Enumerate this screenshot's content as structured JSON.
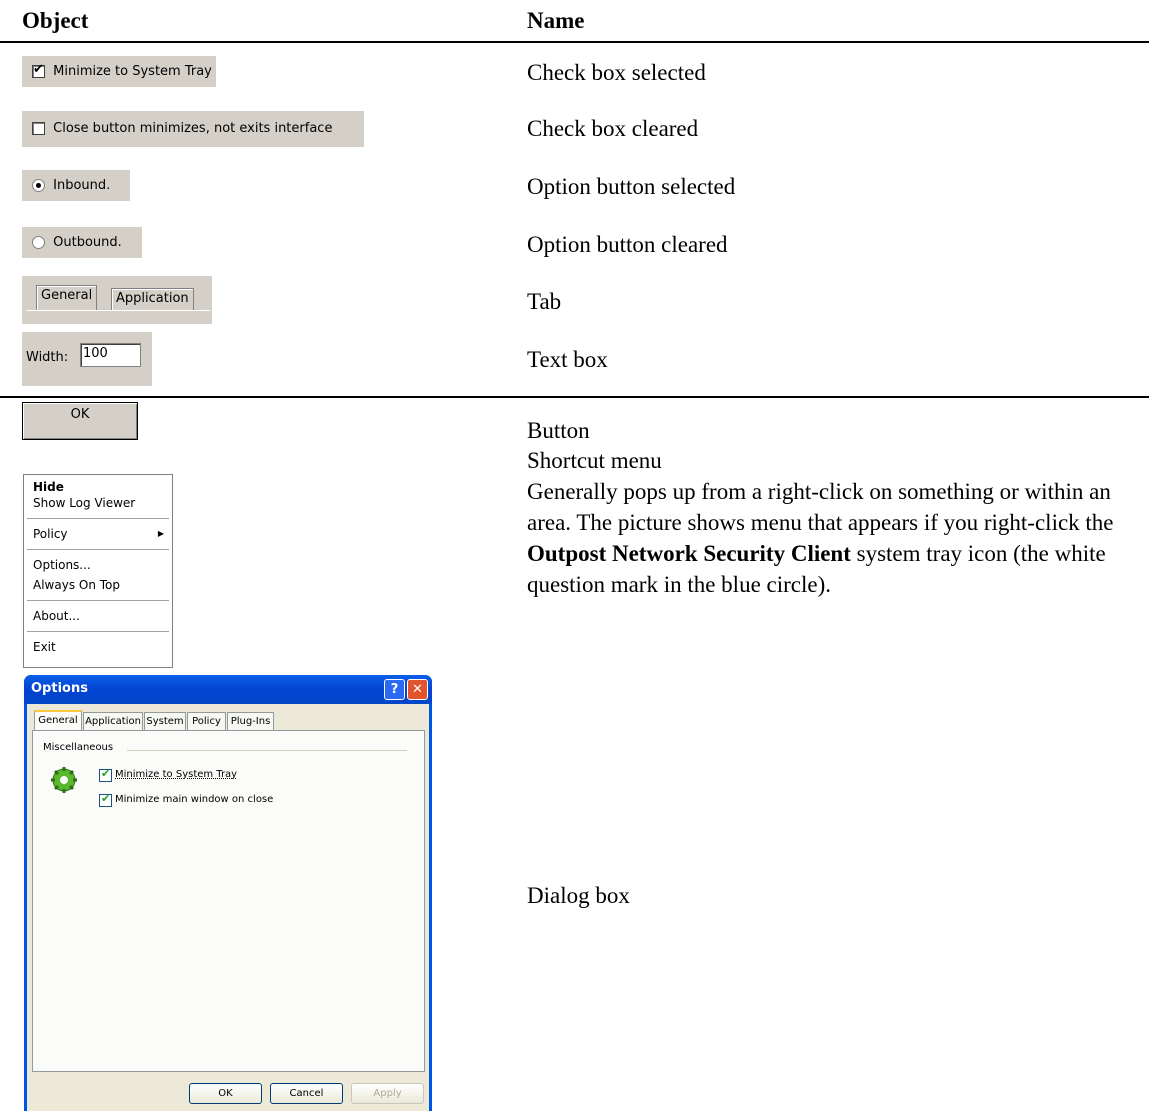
{
  "header": {
    "col_object": "Object",
    "col_name": "Name"
  },
  "rows": {
    "check_selected": {
      "sample": "Minimize to System Tray",
      "name": "Check box selected"
    },
    "check_cleared": {
      "sample": "Close button minimizes, not exits interface",
      "name": "Check box cleared"
    },
    "option_selected": {
      "sample": "Inbound.",
      "name": "Option button selected"
    },
    "option_cleared": {
      "sample": "Outbound.",
      "name": "Option button cleared"
    },
    "tab": {
      "tab1": "General",
      "tab2": "Application",
      "name": "Tab"
    },
    "textbox": {
      "label": "Width:",
      "value": "100",
      "name": "Text box"
    },
    "button": {
      "label": "OK",
      "name": "Button"
    },
    "shortcut_menu": {
      "name": "Shortcut menu",
      "desc_1": "Generally pops up from a right-click on something or within an area. The picture shows menu that appears if you right-click the ",
      "desc_bold": "Outpost Network Security Client",
      "desc_2": " system tray icon (the white question mark in the blue circle).",
      "items": [
        "Hide",
        "Show Log Viewer",
        "Policy",
        "Options...",
        "Always On Top",
        "About...",
        "Exit"
      ]
    },
    "dialog": {
      "name": "Dialog box",
      "title": "Options",
      "help_btn": "?",
      "close_btn": "✕",
      "tabs": [
        "General",
        "Application",
        "System",
        "Policy",
        "Plug-Ins"
      ],
      "group": "Miscellaneous",
      "opt1": "Minimize to System Tray",
      "opt2": "Minimize main window on close",
      "ok": "OK",
      "cancel": "Cancel",
      "apply": "Apply"
    }
  }
}
